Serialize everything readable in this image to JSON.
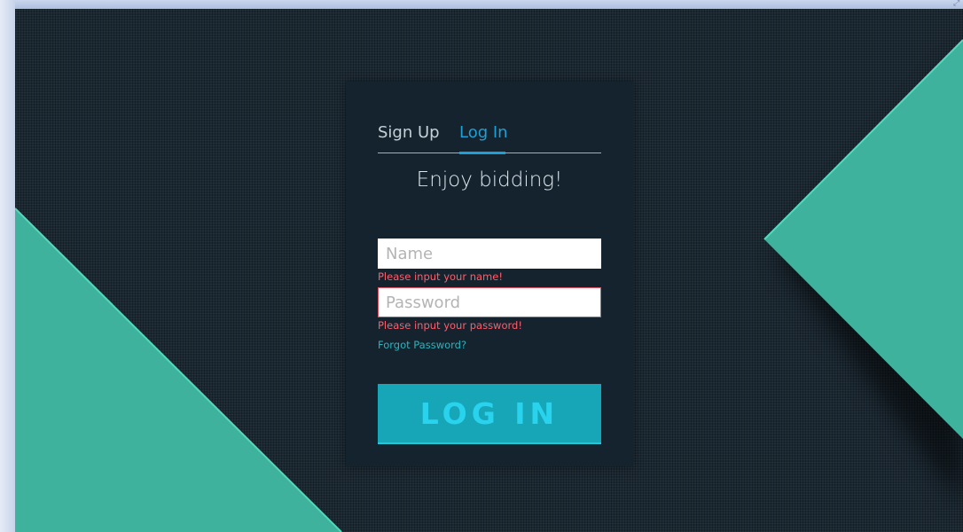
{
  "window": {
    "resize_glyph": "⤢"
  },
  "card": {
    "tabs": [
      {
        "label": "Sign Up",
        "active": false
      },
      {
        "label": "Log In",
        "active": true
      }
    ],
    "tagline": "Enjoy bidding!",
    "name_field": {
      "placeholder": "Name",
      "value": "",
      "error": "Please input your name!"
    },
    "password_field": {
      "placeholder": "Password",
      "value": "",
      "error": "Please input your password!"
    },
    "forgot_label": "Forgot Password?",
    "submit_label": "LOG IN"
  },
  "colors": {
    "background": "#1b2832",
    "card": "#15232e",
    "accent_teal": "#3eb29c",
    "tab_active": "#1d9fd8",
    "error": "#ff5d6a",
    "button": "#17a6b7",
    "button_text": "#29d3ee"
  }
}
